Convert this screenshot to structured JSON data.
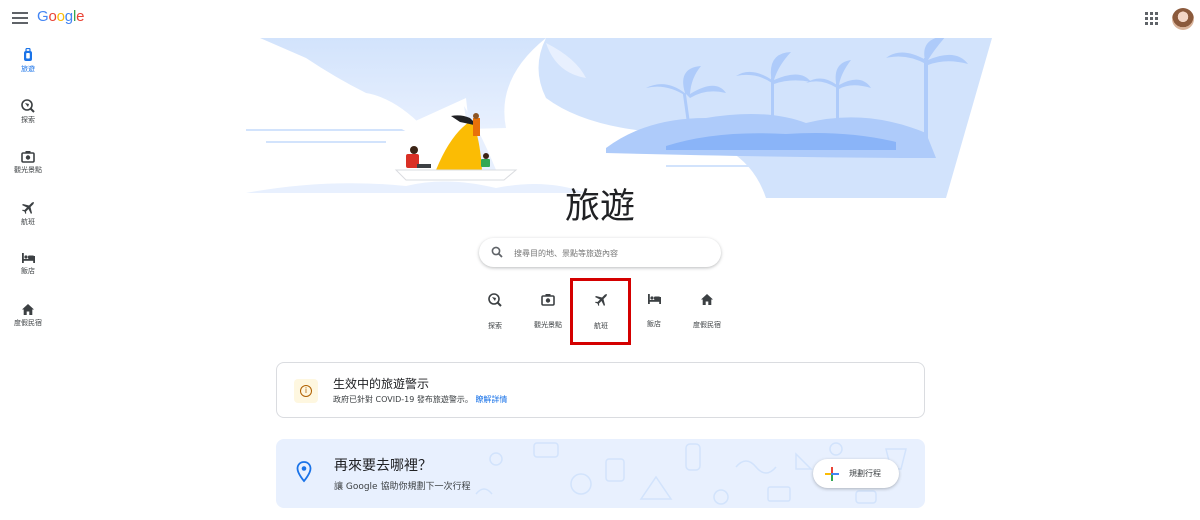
{
  "header": {
    "logo_letters": [
      {
        "ch": "G",
        "color": "#4285F4"
      },
      {
        "ch": "o",
        "color": "#EA4335"
      },
      {
        "ch": "o",
        "color": "#FBBC05"
      },
      {
        "ch": "g",
        "color": "#4285F4"
      },
      {
        "ch": "l",
        "color": "#34A853"
      },
      {
        "ch": "e",
        "color": "#EA4335"
      }
    ],
    "menu_icon": "hamburger-icon",
    "apps_icon": "apps-grid-icon"
  },
  "sidebar": {
    "items": [
      {
        "label": "旅遊",
        "icon": "luggage-icon",
        "active": true
      },
      {
        "label": "探索",
        "icon": "explore-icon",
        "active": false
      },
      {
        "label": "觀光景點",
        "icon": "camera-icon",
        "active": false
      },
      {
        "label": "航班",
        "icon": "flight-icon",
        "active": false
      },
      {
        "label": "飯店",
        "icon": "hotel-icon",
        "active": false
      },
      {
        "label": "度假民宿",
        "icon": "home-icon",
        "active": false
      }
    ]
  },
  "main": {
    "title": "旅遊",
    "search": {
      "placeholder": "搜尋目的地、景點等旅遊內容",
      "icon": "search-icon"
    },
    "categories": [
      {
        "label": "探索",
        "icon": "explore-icon"
      },
      {
        "label": "觀光景點",
        "icon": "camera-icon"
      },
      {
        "label": "航班",
        "icon": "flight-icon",
        "highlighted": true
      },
      {
        "label": "飯店",
        "icon": "hotel-icon"
      },
      {
        "label": "度假民宿",
        "icon": "home-icon"
      }
    ],
    "alert": {
      "title": "生效中的旅遊警示",
      "text": "政府已針對 COVID-19 發布旅遊警示。",
      "link": "瞭解詳情",
      "icon": "info-icon"
    },
    "plan": {
      "title": "再來要去哪裡？",
      "subtitle": "讓 Google 協助你規劃下一次行程",
      "button": "規劃行程",
      "icon": "location-pin-icon",
      "button_icon": "plus-icon"
    }
  },
  "colors": {
    "accent": "#1a73e8",
    "highlight_border": "#d40000",
    "hero_blue": "#aecbfa",
    "plan_card_bg": "#e8f0fe",
    "alert_icon_bg": "#fef7e0"
  }
}
